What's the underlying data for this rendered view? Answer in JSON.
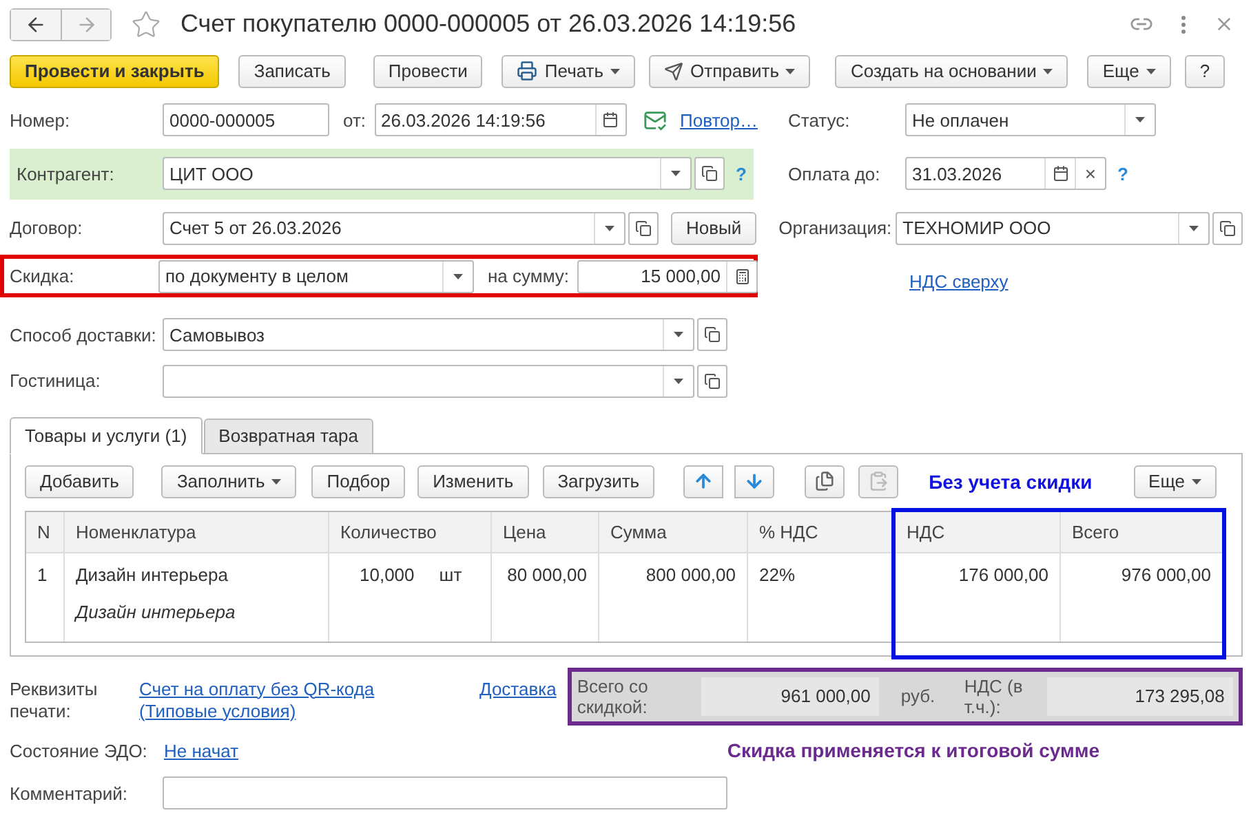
{
  "window": {
    "title": "Счет покупателю 0000-000005 от 26.03.2026 14:19:56",
    "favorite": false
  },
  "toolbar": [
    {
      "label": "Провести и закрыть",
      "kind": "primary"
    },
    {
      "label": "Записать",
      "kind": "plain"
    },
    {
      "label": "Провести",
      "kind": "plain"
    },
    {
      "label": "Печать",
      "kind": "print"
    },
    {
      "label": "Отправить",
      "kind": "send"
    },
    {
      "label": "Создать на основании",
      "kind": "menu"
    },
    {
      "label": "Еще",
      "kind": "menu"
    },
    {
      "label": "?",
      "kind": "plain"
    }
  ],
  "number": {
    "label": "Номер:",
    "value": "0000-000005"
  },
  "date": {
    "label": "от:",
    "value": "26.03.2026 14:19:56"
  },
  "repeat_link": "Повтор…",
  "status": {
    "label": "Статус:",
    "value": "Не оплачен"
  },
  "counterparty": {
    "label": "Контрагент:",
    "value": "ЦИТ ООО",
    "help": "?",
    "highlighted": true
  },
  "payment_due": {
    "label": "Оплата до:",
    "value": "31.03.2026",
    "clear": "×",
    "help": "?"
  },
  "contract": {
    "label": "Договор:",
    "value": "Счет 5 от 26.03.2026",
    "button": "Новый"
  },
  "organization": {
    "label": "Организация:",
    "value": "ТЕХНОМИР ООО"
  },
  "discount": {
    "label": "Скидка:",
    "value": "по документу в целом",
    "amount_label": "на сумму:",
    "amount": "15 000,00",
    "highlighted": true
  },
  "vat_link": "НДС сверху",
  "delivery": {
    "label": "Способ доставки:",
    "value": "Самовывоз"
  },
  "hotel": {
    "label": "Гостиница:"
  },
  "tabs": [
    {
      "label": "Товары и услуги (1)",
      "selected": true
    },
    {
      "label": "Возвратная тара",
      "selected": false
    }
  ],
  "table_toolbar": [
    {
      "label": "Добавить",
      "kind": "plain",
      "disabled": false
    },
    {
      "label": "Заполнить",
      "kind": "menu",
      "disabled": false
    },
    {
      "label": "Подбор",
      "kind": "plain",
      "disabled": false
    },
    {
      "label": "Изменить",
      "kind": "plain",
      "disabled": false
    },
    {
      "label": "Загрузить",
      "kind": "plain",
      "disabled": false
    },
    {
      "kind": "up",
      "disabled": false
    },
    {
      "kind": "down",
      "disabled": false
    },
    {
      "kind": "copy",
      "disabled": false
    },
    {
      "kind": "paste",
      "disabled": true
    },
    {
      "label": "Еще",
      "kind": "menu",
      "disabled": false
    }
  ],
  "columns_note": "Без учета скидки",
  "table": {
    "columns": [
      {
        "label": "N",
        "highlighted": false
      },
      {
        "label": "Номенклатура",
        "highlighted": false
      },
      {
        "label": "Количество",
        "highlighted": false
      },
      {
        "label": "Цена",
        "highlighted": false
      },
      {
        "label": "Сумма",
        "highlighted": false
      },
      {
        "label": "% НДС",
        "highlighted": false
      },
      {
        "label": "НДС",
        "highlighted": true
      },
      {
        "label": "Всего",
        "highlighted": true
      }
    ],
    "rows": [
      {
        "n": "1",
        "item": "Дизайн интерьера",
        "description": "Дизайн интерьера",
        "quantity": "10,000",
        "unit": "шт",
        "price": "80 000,00",
        "sum": "800 000,00",
        "vat_rate": "22%",
        "vat": "176 000,00",
        "total": "976 000,00"
      }
    ]
  },
  "print_forms": {
    "label": "Реквизиты печати:",
    "links": [
      "Счет на оплату без QR-кода (Типовые условия)",
      "Доставка"
    ]
  },
  "totals": {
    "total_label": "Всего со скидкой:",
    "total": "961 000,00",
    "currency": "руб.",
    "vat_label": "НДС (в т.ч.):",
    "vat": "173 295,08",
    "highlighted": true
  },
  "edo": {
    "label": "Состояние ЭДО:",
    "value": "Не начат"
  },
  "totals_note": "Скидка применяется к итоговой сумме",
  "comment": {
    "label": "Комментарий:"
  }
}
